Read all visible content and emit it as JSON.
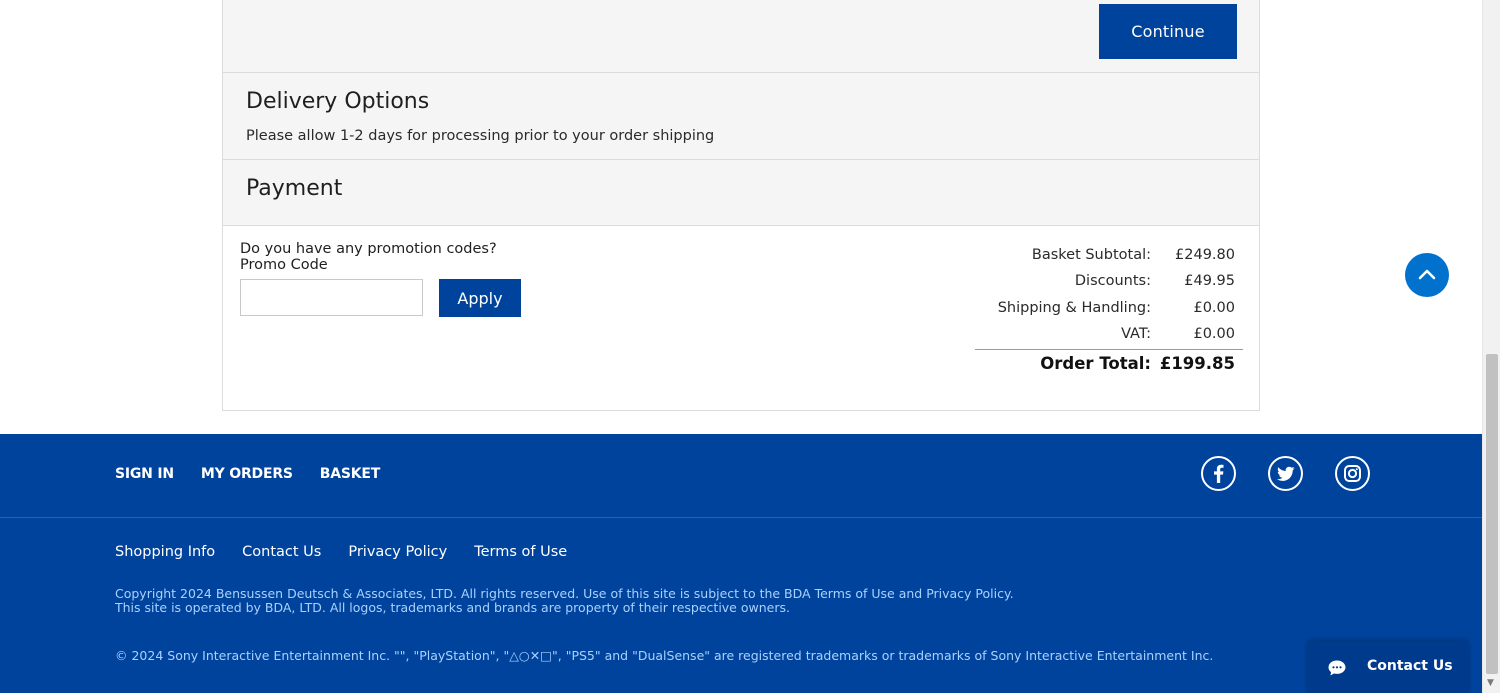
{
  "checkout": {
    "continue_label": "Continue",
    "delivery": {
      "title": "Delivery Options",
      "note": "Please allow 1-2 days for processing prior to your order shipping"
    },
    "payment": {
      "title": "Payment"
    },
    "promo": {
      "question": "Do you have any promotion codes?",
      "label": "Promo Code",
      "value": "",
      "placeholder": "",
      "apply_label": "Apply"
    },
    "totals": [
      {
        "label": "Basket Subtotal:",
        "value": "£249.80"
      },
      {
        "label": "Discounts:",
        "value": "£49.95"
      },
      {
        "label": "Shipping & Handling:",
        "value": "£0.00"
      },
      {
        "label": "VAT:",
        "value": "£0.00"
      }
    ],
    "order_total": {
      "label": "Order Total:",
      "value": "£199.85"
    }
  },
  "back_to_top_icon": "chevron-up-icon",
  "footer": {
    "nav": [
      "SIGN IN",
      "MY ORDERS",
      "BASKET"
    ],
    "social": [
      "facebook-icon",
      "twitter-icon",
      "instagram-icon"
    ],
    "links": [
      "Shopping Info",
      "Contact Us",
      "Privacy Policy",
      "Terms of Use"
    ],
    "copyright_line1": "Copyright 2024 Bensussen Deutsch & Associates, LTD. All rights reserved. Use of this site is subject to the BDA Terms of Use and Privacy Policy.",
    "copyright_line2": "This site is operated by BDA, LTD. All logos, trademarks and brands are property of their respective owners.",
    "sony_notice": "© 2024 Sony Interactive Entertainment Inc. \"\", \"PlayStation\", \"△○✕□\", \"PS5\" and \"DualSense\" are registered trademarks or trademarks of Sony Interactive Entertainment Inc."
  },
  "contact_chip": {
    "label": "Contact Us",
    "icon": "chat-icon"
  },
  "colors": {
    "brand_blue": "#00439c",
    "accent_blue": "#0072ce",
    "light_link": "#a9d1ff"
  }
}
